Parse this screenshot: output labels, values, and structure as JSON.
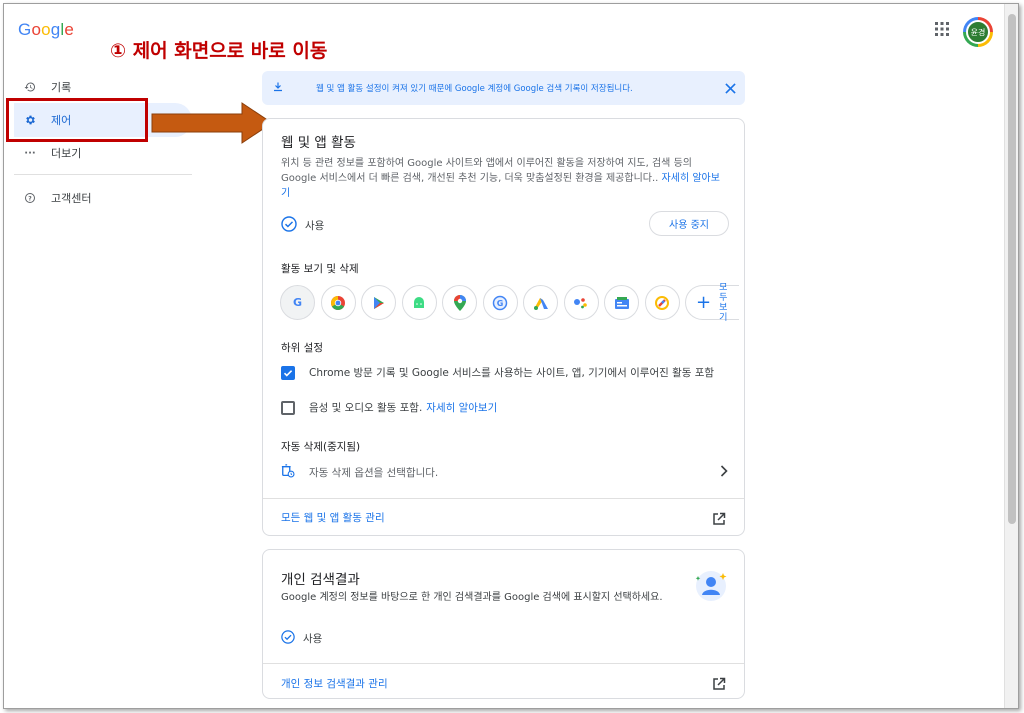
{
  "logo": {
    "text": "Google",
    "letters": [
      "G",
      "o",
      "o",
      "g",
      "l",
      "e"
    ],
    "colors": [
      "#4285f4",
      "#ea4335",
      "#fbbc05",
      "#4285f4",
      "#34a853",
      "#ea4335"
    ]
  },
  "annotation": {
    "title": "① 제어 화면으로 바로 이동",
    "color": "#c00000"
  },
  "sidebar": {
    "items": [
      {
        "label": "기록",
        "icon": "history-icon"
      },
      {
        "label": "제어",
        "icon": "gear-icon",
        "active": true
      },
      {
        "label": "더보기",
        "icon": "more-dots-icon"
      },
      {
        "label": "고객센터",
        "icon": "help-icon"
      }
    ]
  },
  "header": {
    "avatar_label": "윤경",
    "apps_icon": "apps-grid-icon"
  },
  "banner": {
    "text": "웹 및 앱 활동 설정이 켜져 있기 때문에 Google 계정에 Google 검색 기록이 저장됩니다.",
    "icon": "download-icon",
    "close_icon": "close-icon"
  },
  "activity_card": {
    "title": "웹 및 앱 활동",
    "description": "위치 등 관련 정보를 포함하여 Google 사이트와 앱에서 이루어진 활동을 저장하여 지도, 검색 등의 Google 서비스에서 더 빠른 검색, 개선된 추천 기능, 더욱 맞춤설정된 환경을 제공합니다..",
    "learn_more": "자세히 알아보기",
    "status": "사용",
    "pause_button": "사용 중지",
    "view_delete_label": "활동 보기 및 삭제",
    "apps": [
      {
        "name": "google",
        "glyph": "G"
      },
      {
        "name": "chrome",
        "glyph": "●"
      },
      {
        "name": "play",
        "glyph": "▶"
      },
      {
        "name": "android",
        "glyph": "■"
      },
      {
        "name": "maps",
        "glyph": "◆"
      },
      {
        "name": "lens",
        "glyph": "◉"
      },
      {
        "name": "ads",
        "glyph": "▲"
      },
      {
        "name": "assistant",
        "glyph": "●"
      },
      {
        "name": "news",
        "glyph": "▣"
      },
      {
        "name": "discover",
        "glyph": "✎"
      }
    ],
    "more_apps_label": "모두 보기",
    "sub_settings_label": "하위 설정",
    "chrome_option": "Chrome 방문 기록 및 Google 서비스를 사용하는 사이트, 앱, 기기에서 이루어진 활동 포함",
    "chrome_checked": true,
    "audio_option": "음성 및 오디오 활동 포함.",
    "audio_learn_more": "자세히 알아보기",
    "audio_checked": false,
    "auto_delete_label": "자동 삭제(중지됨)",
    "auto_delete_option": "자동 삭제 옵션을 선택합니다.",
    "manage_link": "모든 웹 및 앱 활동 관리"
  },
  "personal_card": {
    "title": "개인 검색결과",
    "description": "Google 계정의 정보를 바탕으로 한 개인 검색결과를 Google 검색에 표시할지 선택하세요.",
    "status": "사용",
    "manage_link": "개인 정보 검색결과 관리"
  }
}
